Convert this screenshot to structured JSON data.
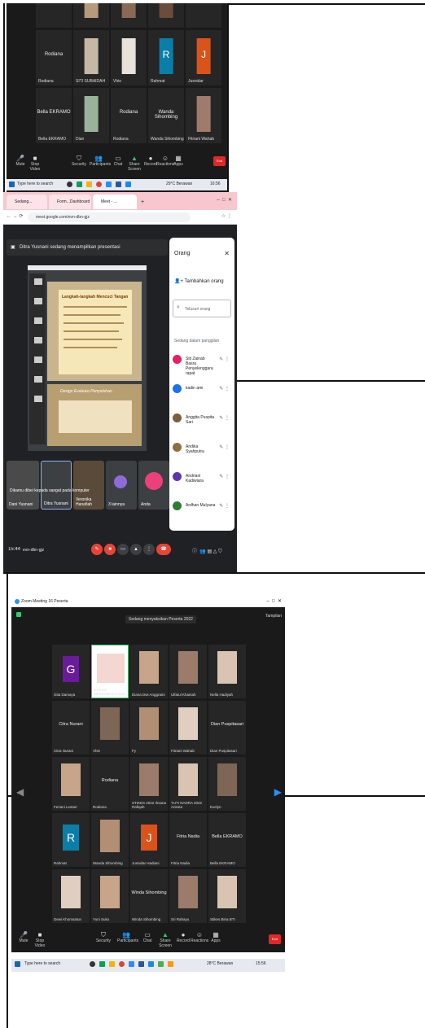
{
  "panel1": {
    "row_top_labels": [
      "",
      "",
      "",
      "",
      ""
    ],
    "tiles": [
      {
        "name": "Rodiana",
        "label": "Rodiana"
      },
      {
        "name": "",
        "label": "SITI SUBAIDAH"
      },
      {
        "name": "",
        "label": "Vhie"
      },
      {
        "name": "",
        "label": "Rahmat"
      },
      {
        "name": "",
        "label": "Jusnidar"
      },
      {
        "name": "Bella EKRAMO",
        "label": "Bella EKRAMO"
      },
      {
        "name": "",
        "label": "Dian"
      },
      {
        "name": "Rodiana",
        "label": "Rodiana"
      },
      {
        "name": "Wanda Sihombing",
        "label": "Wanda Sihombing"
      },
      {
        "name": "",
        "label": "Fitriani Wahab"
      }
    ],
    "letter_tiles": [
      {
        "letter": "R",
        "color": "#0b7ea8"
      },
      {
        "letter": "J",
        "color": "#d9531a"
      }
    ],
    "toolbar": [
      "Mute",
      "Stop Video",
      "Security",
      "Participants",
      "Chat",
      "Share Screen",
      "Record",
      "Reactions",
      "Apps"
    ],
    "end_label": "End",
    "taskbar": {
      "search": "Type here to search",
      "weather": "29°C Berawan",
      "time": "16:56"
    }
  },
  "panel2": {
    "tabs": [
      "Sedang...",
      "Form...Dashboard",
      "Meet - ...",
      "+"
    ],
    "address": "meet.google.com/evn-dbn-gjz",
    "banner": "Ditra Yusnani sedang menampilkan presentasi",
    "people_title": "Orang",
    "add_people": "Tambahkan orang",
    "search_placeholder": "Telusuri orang",
    "in_meeting": "Sedang dalam panggilan",
    "people": [
      {
        "name": "Siti Zainab Basra Penyelenggara rapat",
        "color": "#e91e63"
      },
      {
        "name": "kadin ami",
        "color": "#1a73e8"
      },
      {
        "name": "Anggita Puspita Sari",
        "color": "#7b5e3b"
      },
      {
        "name": "Andika Syahputra",
        "color": "#8d6e3f"
      },
      {
        "name": "Andriani Kadiwiara",
        "color": "#5e35b1"
      },
      {
        "name": "Ardhan Mulyana",
        "color": "#2e7d32"
      }
    ],
    "slide_title": "Langkah-langkah Mencuci Tangan",
    "slide_sub": "Design Evaluasi Penyuluhan",
    "tiles": [
      "Dani Yusnani",
      "Ditra Yusnani",
      "Veronika Hanafiah",
      "3 lainnya",
      "Anda"
    ],
    "tip": "Dikamu dibei kepada sangat pada komputer",
    "time": "15:44",
    "meeting_code": "evn-dbn-gjz"
  },
  "panel3": {
    "window_title": "Zoom Meeting 16 Peserta",
    "view_label": "Tampilan",
    "banner": "Sedang menyaksikan Peserta 2022",
    "grid": [
      [
        {
          "type": "letter",
          "letter": "G",
          "color": "#6a1b9a",
          "label": "Gita Damaya"
        },
        {
          "type": "logo",
          "label": "STIKES MERCUBAKTIJAYA"
        },
        {
          "type": "photo",
          "label": "Diana Dwi Anggraini"
        },
        {
          "type": "photo",
          "label": "Ulfatul Khairiah"
        },
        {
          "type": "photo",
          "label": "Nella Hadiyah"
        }
      ],
      [
        {
          "type": "name",
          "name": "Citra Nurani",
          "label": "Citra Nurani"
        },
        {
          "type": "photo",
          "label": "Vhie"
        },
        {
          "type": "photo",
          "label": "Fy"
        },
        {
          "type": "photo",
          "label": "Fitriani Wahab"
        },
        {
          "type": "name",
          "name": "Dian Puspitasari",
          "label": "Dian Puspitasari"
        }
      ],
      [
        {
          "type": "photo",
          "label": "Feriani Lestari"
        },
        {
          "type": "name",
          "name": "Rodiana",
          "label": "Rodiana"
        },
        {
          "type": "photo",
          "label": "STIKES 2022 Ihsana Rafiqah"
        },
        {
          "type": "photo",
          "label": "TUTI NADRA 2022 Ariesta"
        },
        {
          "type": "photo",
          "label": "Evelyn"
        }
      ],
      [
        {
          "type": "letter",
          "letter": "R",
          "color": "#0b7ea8",
          "label": "Rahmat"
        },
        {
          "type": "photo",
          "label": "Wanda Sihombing"
        },
        {
          "type": "letter",
          "letter": "J",
          "color": "#d9531a",
          "label": "Jusnidar Hadiani"
        },
        {
          "type": "name",
          "name": "Fitria Nadia",
          "label": "Fitria Nadia"
        },
        {
          "type": "name",
          "name": "Bella EKRAMO",
          "label": "Bella EKRAMO"
        }
      ],
      [
        {
          "type": "photo",
          "label": "Dewi Khomsatun"
        },
        {
          "type": "photo",
          "label": "Yuni Suko"
        },
        {
          "type": "name",
          "name": "Winda Sihombing",
          "label": "Winda Sihombing"
        },
        {
          "type": "photo",
          "label": "Sri Rahayu"
        },
        {
          "type": "photo",
          "label": "Stikes Bina BTI"
        }
      ]
    ],
    "toolbar": [
      "Mute",
      "Stop Video",
      "Security",
      "Participants",
      "Chat",
      "Share Screen",
      "Record",
      "Reactions",
      "Apps"
    ],
    "end_label": "End",
    "taskbar": {
      "search": "Type here to search",
      "weather": "28°C Berawan",
      "time": "15:56"
    }
  }
}
